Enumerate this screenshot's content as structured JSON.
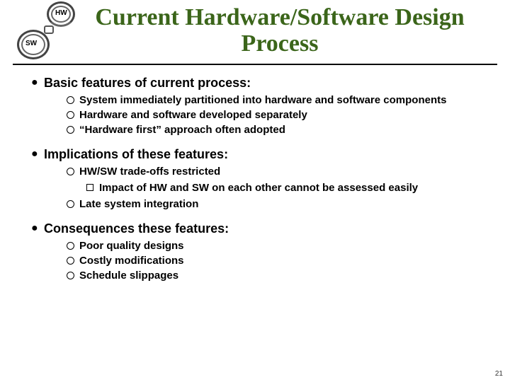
{
  "logo": {
    "hw": "HW",
    "sw": "SW"
  },
  "title": "Current Hardware/Software Design Process",
  "sections": [
    {
      "heading": "Basic features of current process:",
      "items": [
        {
          "text": "System immediately partitioned into hardware and software components"
        },
        {
          "text": " Hardware and software developed separately"
        },
        {
          "text": "“Hardware first” approach often adopted"
        }
      ]
    },
    {
      "heading": "Implications of these features:",
      "items": [
        {
          "text": "HW/SW trade-offs restricted",
          "sub": [
            {
              "text": "Impact of HW and SW on each other cannot be assessed easily"
            }
          ]
        },
        {
          "text": "Late system integration"
        }
      ]
    },
    {
      "heading": "Consequences these features:",
      "items": [
        {
          "text": "Poor quality designs"
        },
        {
          "text": "Costly modifications"
        },
        {
          "text": "Schedule slippages"
        }
      ]
    }
  ],
  "slide_number": "21"
}
